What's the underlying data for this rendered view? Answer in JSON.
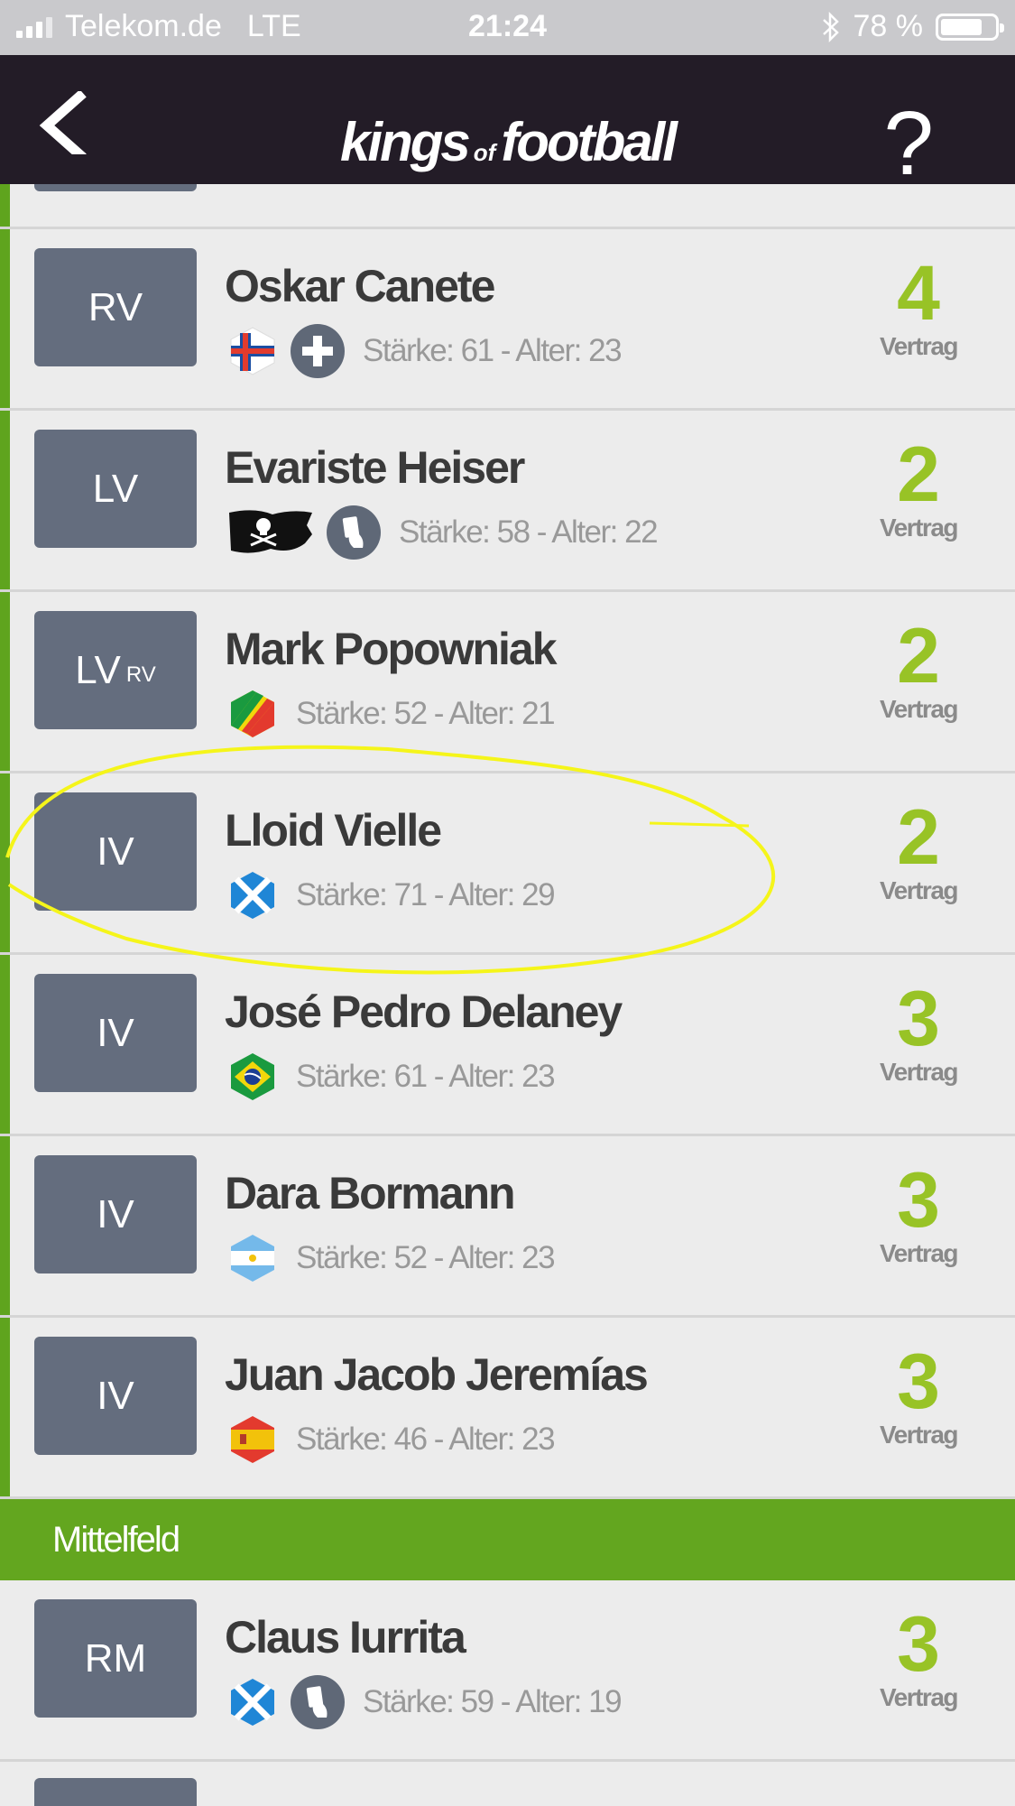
{
  "status_bar": {
    "carrier": "Telekom.de",
    "network": "LTE",
    "time": "21:24",
    "battery": "78 %",
    "battery_level": 0.78
  },
  "header": {
    "logo_main_1": "kings",
    "logo_of": "of",
    "logo_main_2": "football",
    "help": "?"
  },
  "section_defense_rows": [
    {
      "pos": "RV",
      "pos_sub": "",
      "name": "Oskar Canete",
      "stats": "Stärke: 61 - Alter: 23",
      "contract": "4",
      "contract_label": "Vertrag",
      "flag": "faroe-islands-flag-icon",
      "badge": "plus-icon"
    },
    {
      "pos": "LV",
      "pos_sub": "",
      "name": "Evariste Heiser",
      "stats": "Stärke: 58 - Alter: 22",
      "contract": "2",
      "contract_label": "Vertrag",
      "flag": "pirate-flag-icon",
      "badge": "card-icon"
    },
    {
      "pos": "LV",
      "pos_sub": "RV",
      "name": "Mark Popowniak",
      "stats": "Stärke: 52 - Alter: 21",
      "contract": "2",
      "contract_label": "Vertrag",
      "flag": "congo-flag-icon",
      "badge": ""
    },
    {
      "pos": "IV",
      "pos_sub": "",
      "name": "Lloid Vielle",
      "stats": "Stärke: 71 - Alter: 29",
      "contract": "2",
      "contract_label": "Vertrag",
      "flag": "scotland-flag-icon",
      "badge": ""
    },
    {
      "pos": "IV",
      "pos_sub": "",
      "name": "José Pedro Delaney",
      "stats": "Stärke: 61 - Alter: 23",
      "contract": "3",
      "contract_label": "Vertrag",
      "flag": "brazil-flag-icon",
      "badge": ""
    },
    {
      "pos": "IV",
      "pos_sub": "",
      "name": "Dara Bormann",
      "stats": "Stärke: 52 - Alter: 23",
      "contract": "3",
      "contract_label": "Vertrag",
      "flag": "argentina-flag-icon",
      "badge": ""
    },
    {
      "pos": "IV",
      "pos_sub": "",
      "name": "Juan Jacob Jeremías",
      "stats": "Stärke: 46 - Alter: 23",
      "contract": "3",
      "contract_label": "Vertrag",
      "flag": "spain-flag-icon",
      "badge": ""
    }
  ],
  "section_midfield": {
    "title": "Mittelfeld",
    "rows": [
      {
        "pos": "RM",
        "pos_sub": "",
        "name": "Claus Iurrita",
        "stats": "Stärke: 59 - Alter: 19",
        "contract": "3",
        "contract_label": "Vertrag",
        "flag": "scotland-flag-icon",
        "badge": "card-icon"
      }
    ]
  },
  "colors": {
    "header_bg": "#231c27",
    "accent_green": "#63a61f",
    "contract_green": "#98c326",
    "position_badge": "#646d7e",
    "highlight": "#f5f51a"
  }
}
